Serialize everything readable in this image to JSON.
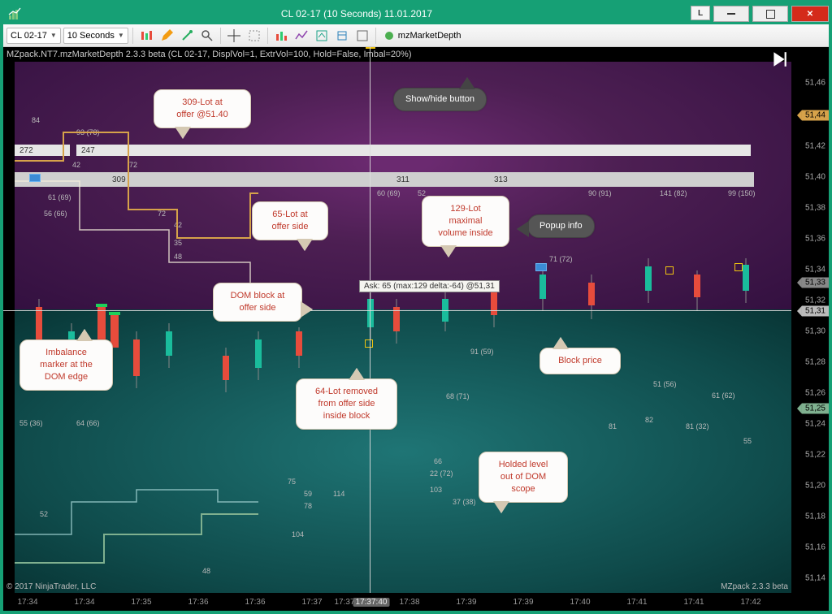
{
  "window": {
    "title": "CL 02-17 (10 Seconds)  11.01.2017",
    "letter_btn": "L",
    "close_glyph": "✕"
  },
  "toolbar": {
    "instrument": "CL 02-17",
    "period": "10 Seconds",
    "market_depth": "mzMarketDepth"
  },
  "chart": {
    "info_line": "MZpack.NT7.mzMarketDepth 2.3.3 beta (CL 02-17, DisplVol=1, ExtrVol=100, Hold=False, Imbal=20%)",
    "copyright": "© 2017 NinjaTrader, LLC",
    "version_text": "MZpack 2.3.3 beta",
    "price_ticks": [
      "51,46",
      "51,44",
      "51,42",
      "51,40",
      "51,38",
      "51,36",
      "51,34",
      "51,32",
      "51,30",
      "51,28",
      "51,26",
      "51,24",
      "51,22",
      "51,20",
      "51,18",
      "51,16",
      "51,14"
    ],
    "markers": {
      "current": "51,44",
      "ask": "51,33",
      "cross": "51,31",
      "bid": "51,25"
    },
    "time_ticks": [
      "17:34",
      "17:34",
      "17:35",
      "17:36",
      "17:36",
      "17:37",
      "17:37",
      "17:37:40",
      "17:38",
      "17:39",
      "17:39",
      "17:40",
      "17:41",
      "17:41",
      "17:42"
    ],
    "popup": "Ask: 65 (max:129 delta:-64) @51,31",
    "hbars": {
      "row1_a": "272",
      "row1_b": "247",
      "row2": "309",
      "row2_mid": "311",
      "row2_right": "313"
    },
    "cell_labels": {
      "tl1": "84",
      "tl2": "93 (78)",
      "r1a": "42",
      "r1b": "72",
      "r2a": "61 (69)",
      "r2b": "56 (66)",
      "r2c": "72",
      "r2d": "42",
      "r3a": "35",
      "r3b": "48",
      "mid1": "60 (69)",
      "mid2": "52",
      "mid3": "71 (72)",
      "mid4": "90 (91)",
      "mid5": "141 (82)",
      "mid6": "99 (150)",
      "bid1": "55 (36)",
      "bid2": "64 (66)",
      "bid3": "68 (71)",
      "bid4": "91 (59)",
      "bid5": "81",
      "bid6": "82",
      "bid7": "81 (32)",
      "bid8": "55",
      "bid9": "51 (56)",
      "bid10": "61 (62)",
      "low1": "52",
      "low2": "75",
      "low3": "59",
      "low4": "78",
      "low5": "104",
      "low6": "114",
      "low7": "66",
      "low8": "103",
      "low9": "37 (38)",
      "low10": "22 (72)",
      "low11": "48"
    }
  },
  "callouts": {
    "lot309": "309-Lot at\noffer @51.40",
    "lot65": "65-Lot at\noffer side",
    "lot129": "129-Lot\nmaximal\nvolume inside",
    "showhide": "Show/hide button",
    "popup_info": "Popup info",
    "dom_block": "DOM block at\noffer side",
    "imbalance": "Imbalance\nmarker at the\nDOM edge",
    "lot64": "64-Lot removed\nfrom offer side\ninside block",
    "block_price": "Block price",
    "hold_level": "Holded level\nout of DOM\nscope"
  },
  "chart_data": {
    "type": "heatmap",
    "instrument": "CL 02-17",
    "timeframe": "10s",
    "price_range": [
      51.13,
      51.47
    ],
    "key_levels": {
      "offer_blocks": [
        {
          "price": 51.42,
          "lots": [
            272,
            247
          ]
        },
        {
          "price": 51.4,
          "lots": [
            309,
            311,
            313
          ]
        }
      ],
      "ask_popup": {
        "price": 51.31,
        "lot": 65,
        "max": 129,
        "delta": -64
      }
    }
  }
}
